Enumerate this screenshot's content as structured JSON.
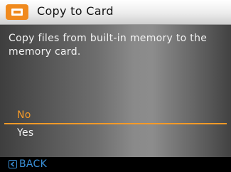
{
  "header": {
    "title": "Copy to Card",
    "icon": "memory-card-icon",
    "accent_color": "#f08a1e"
  },
  "dialog": {
    "message": "Copy files from built-in  memory to the\nmemory card."
  },
  "options": [
    {
      "label": "No",
      "selected": true
    },
    {
      "label": "Yes",
      "selected": false
    }
  ],
  "colors": {
    "selected_text": "#f59a28",
    "back_control": "#3a8fd6"
  },
  "footer": {
    "back_label": "BACK",
    "back_icon": "left-arrow-box-icon"
  }
}
